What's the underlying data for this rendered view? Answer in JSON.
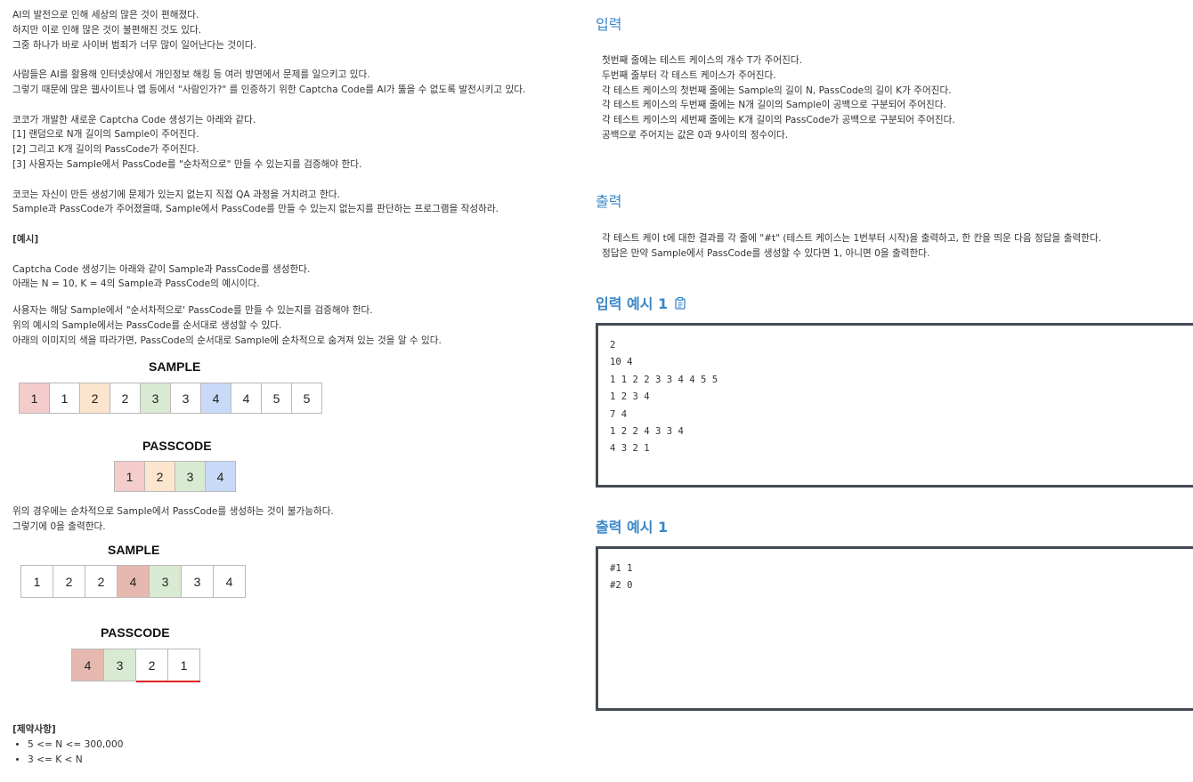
{
  "problem": {
    "lines_block1": [
      "AI의 발전으로 인해 세상의 많은 것이 편해졌다.",
      "하지만 이로 인해 많은 것이 불편해진 것도 있다.",
      "그중 하나가 바로 사이버 범죄가 너무 많이 일어난다는 것이다."
    ],
    "lines_block2": [
      "사람들은 AI를 활용해 인터넷상에서 개인정보 해킹 등 여러 방면에서 문제를 일으키고 있다.",
      "그렇기 때문에 많은 웹사이트나 앱 등에서 \"사람인가?\" 를 인증하기 위한 Captcha Code를 AI가 뚫을 수 없도록 발전시키고 있다."
    ],
    "lines_block3": [
      "코코가 개발한 새로운 Captcha Code 생성기는 아래와 같다.",
      "[1] 랜덤으로 N개 길이의 Sample이 주어진다.",
      "[2] 그리고 K개 길이의 PassCode가 주어진다.",
      "[3] 사용자는 Sample에서 PassCode를 \"순차적으로\" 만들 수 있는지를 검증해야 한다."
    ],
    "lines_block4": [
      "코코는 자신이 만든 생성기에 문제가 있는지 없는지 직접 QA 과정을 거치려고 한다.",
      "Sample과 PassCode가 주어졌을때, Sample에서 PassCode를 만들 수 있는지 없는지를 판단하는 프로그램을 작성하라."
    ],
    "example_heading": "[예시]",
    "lines_block5": [
      "Captcha Code 생성기는 아래와 같이 Sample과 PassCode를 생성한다.",
      "아래는 N = 10, K = 4의 Sample과 PassCode의 예시이다."
    ],
    "lines_block6": [
      "사용자는 해당 Sample에서 \"순서차적으로' PassCode를 만들 수 있는지를 검증해야 한다.",
      "위의 예시의 Sample에서는 PassCode를 순서대로 생성할 수 있다.",
      "아래의 이미지의 색을 따라가면, PassCode의 순서대로 Sample에 순차적으로 숨겨져 있는 것을 알 수 있다."
    ],
    "lines_block7": [
      "위의 경우에는 순차적으로 Sample에서 PassCode를 생성하는 것이 불가능하다.",
      "그렇기에 0을 출력한다."
    ],
    "constraints_heading": "[제약사항]",
    "constraints": [
      "5 <= N <= 300,000",
      "3 <= K < N"
    ]
  },
  "diagram1": {
    "sample_title": "SAMPLE",
    "sample": [
      {
        "v": "1",
        "color": "#f4cccc"
      },
      {
        "v": "1",
        "color": "#ffffff"
      },
      {
        "v": "2",
        "color": "#fce5cd"
      },
      {
        "v": "2",
        "color": "#ffffff"
      },
      {
        "v": "3",
        "color": "#d9ead3"
      },
      {
        "v": "3",
        "color": "#ffffff"
      },
      {
        "v": "4",
        "color": "#c9daf8"
      },
      {
        "v": "4",
        "color": "#ffffff"
      },
      {
        "v": "5",
        "color": "#ffffff"
      },
      {
        "v": "5",
        "color": "#ffffff"
      }
    ],
    "passcode_title": "PASSCODE",
    "passcode": [
      {
        "v": "1",
        "color": "#f4cccc"
      },
      {
        "v": "2",
        "color": "#fce5cd"
      },
      {
        "v": "3",
        "color": "#d9ead3"
      },
      {
        "v": "4",
        "color": "#c9daf8"
      }
    ]
  },
  "diagram2": {
    "sample_title": "SAMPLE",
    "sample": [
      {
        "v": "1",
        "color": "#ffffff"
      },
      {
        "v": "2",
        "color": "#ffffff"
      },
      {
        "v": "2",
        "color": "#ffffff"
      },
      {
        "v": "4",
        "color": "#e6b8af"
      },
      {
        "v": "3",
        "color": "#d9ead3"
      },
      {
        "v": "3",
        "color": "#ffffff"
      },
      {
        "v": "4",
        "color": "#ffffff"
      }
    ],
    "passcode_title": "PASSCODE",
    "passcode": [
      {
        "v": "4",
        "color": "#e6b8af"
      },
      {
        "v": "3",
        "color": "#d9ead3"
      },
      {
        "v": "2",
        "color": "#ffffff"
      },
      {
        "v": "1",
        "color": "#ffffff"
      }
    ],
    "underline_color": "#e02020"
  },
  "input_section": {
    "title": "입력",
    "lines": [
      "첫번째 줄에는 테스트 케이스의 개수 T가 주어진다.",
      "두번째 줄부터 각 테스트 케이스가 주어진다.",
      "각 테스트 케이스의 첫번째 줄에는 Sample의 길이 N, PassCode의 길이 K가 주어진다.",
      "각 테스트 케이스의 두번째 줄에는 N개 길이의 Sample이 공백으로 구분되어 주어진다.",
      "각 테스트 케이스의 세번째 줄에는 K개 길이의 PassCode가 공백으로 구분되어 주어진다.",
      "공백으로 주어지는 값은 0과 9사이의 정수이다."
    ]
  },
  "output_section": {
    "title": "출력",
    "lines": [
      "각 테스트 케이 t에 대한 결과를 각 줄에 \"#t\" (테스트 케이스는 1번부터 시작)을 출력하고, 한 칸을 띄운 다음 정답을 출력한다.",
      "정답은 만약 Sample에서 PassCode를 생성할 수 있다면 1, 아니면 0을 출력한다."
    ]
  },
  "input_example": {
    "title": "입력 예시 1",
    "icon": "clipboard-icon",
    "lines": [
      "2",
      "10 4",
      "1 1 2 2 3 3 4 4 5 5",
      "1 2 3 4",
      "7 4",
      "1 2 2 4 3 3 4",
      "4 3 2 1"
    ]
  },
  "output_example": {
    "title": "출력 예시 1",
    "lines": [
      "#1 1",
      "#2 0"
    ]
  },
  "colors": {
    "accent": "#3a87c9",
    "box_border": "#444b54"
  }
}
